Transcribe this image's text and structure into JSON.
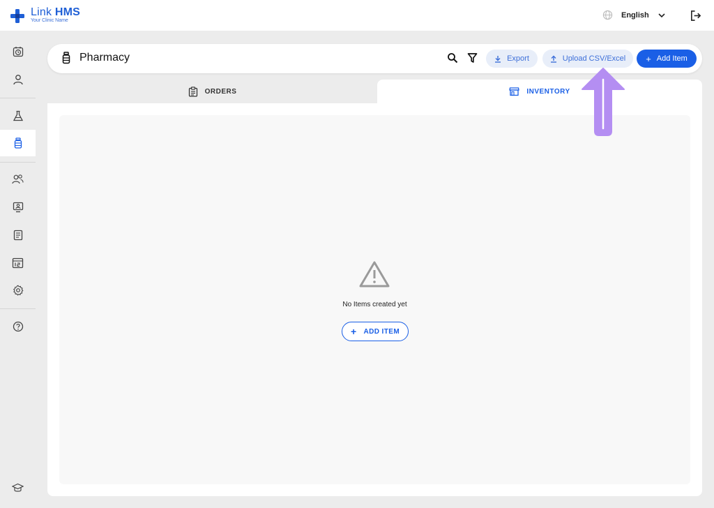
{
  "brand": {
    "name_part1": "Link",
    "name_part2": "HMS",
    "subtitle": "Your Clinic Name"
  },
  "topbar": {
    "language": "English",
    "globe_icon": "globe-icon",
    "logout_icon": "logout-icon"
  },
  "sidebar": {
    "items": [
      {
        "icon": "clock-icon"
      },
      {
        "icon": "user-icon"
      },
      {
        "icon": "lab-flask-icon"
      },
      {
        "icon": "pharmacy-bottle-icon",
        "active": true
      },
      {
        "icon": "users-icon"
      },
      {
        "icon": "monitor-user-icon"
      },
      {
        "icon": "report-icon"
      },
      {
        "icon": "chart-icon"
      },
      {
        "icon": "settings-icon"
      },
      {
        "icon": "help-icon"
      },
      {
        "icon": "graduation-cap-icon"
      }
    ]
  },
  "header": {
    "title": "Pharmacy",
    "export_label": "Export",
    "upload_label": "Upload CSV/Excel",
    "add_label": "Add Item"
  },
  "tabs": [
    {
      "label": "ORDERS",
      "active": false
    },
    {
      "label": "INVENTORY",
      "active": true
    }
  ],
  "empty": {
    "message": "No Items created yet",
    "button_label": "ADD ITEM"
  },
  "colors": {
    "primary": "#1a5fe6",
    "light_pill": "#e8eef9",
    "arrow": "#b48ef2"
  }
}
